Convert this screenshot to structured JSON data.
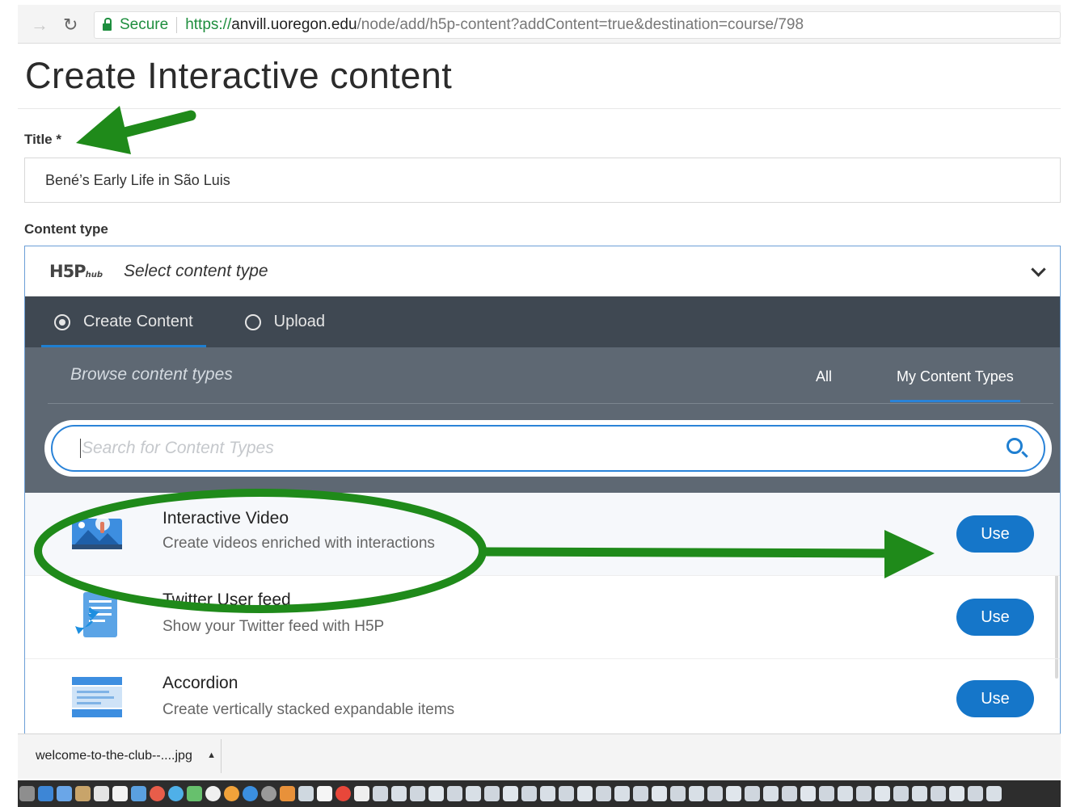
{
  "browser": {
    "secure_label": "Secure",
    "url_scheme": "https://",
    "url_host": "anvill.uoregon.edu",
    "url_path": "/node/add/h5p-content?addContent=true&destination=course/798"
  },
  "page": {
    "title": "Create Interactive content",
    "title_field_label": "Title",
    "required_marker": "*",
    "title_value": "Bené’s Early Life in São Luis",
    "content_type_label": "Content type"
  },
  "hub": {
    "logo": "H5P",
    "logo_suffix": "hub",
    "select_placeholder": "Select content type",
    "tabs": [
      {
        "label": "Create Content",
        "selected": true
      },
      {
        "label": "Upload",
        "selected": false
      }
    ],
    "browse_title": "Browse content types",
    "filters": {
      "all": "All",
      "mine": "My Content Types"
    },
    "search_placeholder": "Search for Content Types",
    "items": [
      {
        "title": "Interactive Video",
        "description": "Create videos enriched with interactions",
        "button": "Use",
        "icon": "interactive-video-icon"
      },
      {
        "title": "Twitter User feed",
        "description": "Show your Twitter feed with H5P",
        "button": "Use",
        "icon": "twitter-feed-icon"
      },
      {
        "title": "Accordion",
        "description": "Create vertically stacked expandable items",
        "button": "Use",
        "icon": "accordion-icon"
      }
    ]
  },
  "downloads": {
    "file_name": "welcome-to-the-club--....jpg"
  },
  "colors": {
    "annotation_green": "#1f8a1a",
    "accent_blue": "#1576c9",
    "hub_dark": "#3f4852",
    "hub_mid": "#5e6873"
  }
}
